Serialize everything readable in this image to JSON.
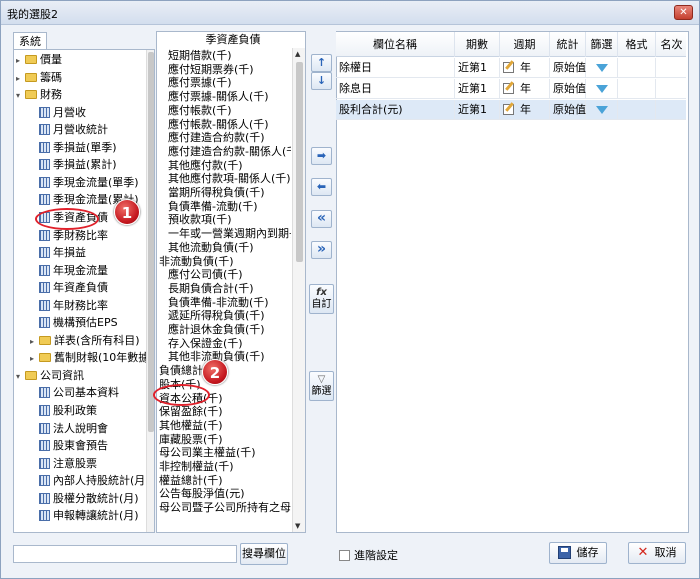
{
  "window": {
    "title": "我的選股2",
    "close_glyph": "✕"
  },
  "left_tab": {
    "label": "系統"
  },
  "tree": [
    {
      "indent": 0,
      "toggle": "▸",
      "icon": "folder",
      "label": "價量"
    },
    {
      "indent": 0,
      "toggle": "▸",
      "icon": "folder",
      "label": "籌碼"
    },
    {
      "indent": 0,
      "toggle": "▾",
      "icon": "folder",
      "label": "財務"
    },
    {
      "indent": 1,
      "toggle": "",
      "icon": "table",
      "label": "月營收"
    },
    {
      "indent": 1,
      "toggle": "",
      "icon": "table",
      "label": "月營收統計"
    },
    {
      "indent": 1,
      "toggle": "",
      "icon": "table",
      "label": "季損益(單季)"
    },
    {
      "indent": 1,
      "toggle": "",
      "icon": "table",
      "label": "季損益(累計)"
    },
    {
      "indent": 1,
      "toggle": "",
      "icon": "table",
      "label": "季現金流量(單季)"
    },
    {
      "indent": 1,
      "toggle": "",
      "icon": "table",
      "label": "季現金流量(累計)"
    },
    {
      "indent": 1,
      "toggle": "",
      "icon": "table",
      "label": "季資產負債"
    },
    {
      "indent": 1,
      "toggle": "",
      "icon": "table",
      "label": "季財務比率"
    },
    {
      "indent": 1,
      "toggle": "",
      "icon": "table",
      "label": "年損益"
    },
    {
      "indent": 1,
      "toggle": "",
      "icon": "table",
      "label": "年現金流量"
    },
    {
      "indent": 1,
      "toggle": "",
      "icon": "table",
      "label": "年資產負債"
    },
    {
      "indent": 1,
      "toggle": "",
      "icon": "table",
      "label": "年財務比率"
    },
    {
      "indent": 1,
      "toggle": "",
      "icon": "table",
      "label": "機構預估EPS"
    },
    {
      "indent": 1,
      "toggle": "▸",
      "icon": "folder",
      "label": "詳表(含所有科目)"
    },
    {
      "indent": 1,
      "toggle": "▸",
      "icon": "folder",
      "label": "舊制財報(10年數據)"
    },
    {
      "indent": 0,
      "toggle": "▾",
      "icon": "folder",
      "label": "公司資訊"
    },
    {
      "indent": 1,
      "toggle": "",
      "icon": "table",
      "label": "公司基本資料"
    },
    {
      "indent": 1,
      "toggle": "",
      "icon": "table",
      "label": "股利政策"
    },
    {
      "indent": 1,
      "toggle": "",
      "icon": "table",
      "label": "法人說明會"
    },
    {
      "indent": 1,
      "toggle": "",
      "icon": "table",
      "label": "股東會預告"
    },
    {
      "indent": 1,
      "toggle": "",
      "icon": "table",
      "label": "注意股票"
    },
    {
      "indent": 1,
      "toggle": "",
      "icon": "table",
      "label": "內部人持股統計(月)"
    },
    {
      "indent": 1,
      "toggle": "",
      "icon": "table",
      "label": "股權分散統計(月)"
    },
    {
      "indent": 1,
      "toggle": "",
      "icon": "table",
      "label": "申報轉讓統計(月)"
    }
  ],
  "middle": {
    "header": "季資產負債",
    "items": [
      {
        "indent": 1,
        "label": "短期借款(千)"
      },
      {
        "indent": 1,
        "label": "應付短期票券(千)"
      },
      {
        "indent": 1,
        "label": "應付票據(千)"
      },
      {
        "indent": 1,
        "label": "應付票據-關係人(千)"
      },
      {
        "indent": 1,
        "label": "應付帳款(千)"
      },
      {
        "indent": 1,
        "label": "應付帳款-關係人(千)"
      },
      {
        "indent": 1,
        "label": "應付建造合約款(千)"
      },
      {
        "indent": 1,
        "label": "應付建造合約款-關係人(千)"
      },
      {
        "indent": 1,
        "label": "其他應付款(千)"
      },
      {
        "indent": 1,
        "label": "其他應付款項-關係人(千)"
      },
      {
        "indent": 1,
        "label": "當期所得稅負債(千)"
      },
      {
        "indent": 1,
        "label": "負債準備-流動(千)"
      },
      {
        "indent": 1,
        "label": "預收款項(千)"
      },
      {
        "indent": 1,
        "label": "一年或一營業週期內到期長期"
      },
      {
        "indent": 1,
        "label": "其他流動負債(千)"
      },
      {
        "indent": 0,
        "label": "非流動負債(千)"
      },
      {
        "indent": 1,
        "label": "應付公司債(千)"
      },
      {
        "indent": 1,
        "label": "長期負債合計(千)"
      },
      {
        "indent": 1,
        "label": "負債準備-非流動(千)"
      },
      {
        "indent": 1,
        "label": "遞延所得稅負債(千)"
      },
      {
        "indent": 1,
        "label": "應計退休金負債(千)"
      },
      {
        "indent": 1,
        "label": "存入保證金(千)"
      },
      {
        "indent": 1,
        "label": "其他非流動負債(千)"
      },
      {
        "indent": 0,
        "label": "負債總計(千)"
      },
      {
        "indent": 0,
        "label": "股本(千)"
      },
      {
        "indent": 0,
        "label": "資本公積(千)"
      },
      {
        "indent": 0,
        "label": "保留盈餘(千)"
      },
      {
        "indent": 0,
        "label": "其他權益(千)"
      },
      {
        "indent": 0,
        "label": "庫藏股票(千)"
      },
      {
        "indent": 0,
        "label": "母公司業主權益(千)"
      },
      {
        "indent": 0,
        "label": "非控制權益(千)"
      },
      {
        "indent": 0,
        "label": "權益總計(千)"
      },
      {
        "indent": 0,
        "label": "公告每股淨值(元)"
      },
      {
        "indent": 0,
        "label": "母公司暨子公司所持有之母公司"
      }
    ]
  },
  "buttons": {
    "move_up": "↑",
    "move_down": "↓",
    "add_one": "➡",
    "remove_one": "⬅",
    "remove_all": "«",
    "add_all": "»",
    "custom_icon": "fx",
    "custom": "自訂",
    "filter_icon": "▽",
    "filter": "篩選"
  },
  "grid": {
    "columns": [
      "欄位名稱",
      "期數",
      "週期",
      "統計",
      "篩選",
      "格式",
      "名次"
    ],
    "rows": [
      {
        "name": "除權日",
        "period": "近第1",
        "cycle": "年",
        "stat": "原始值"
      },
      {
        "name": "除息日",
        "period": "近第1",
        "cycle": "年",
        "stat": "原始值"
      },
      {
        "name": "股利合計(元)",
        "period": "近第1",
        "cycle": "年",
        "stat": "原始值"
      }
    ]
  },
  "footer": {
    "search_value": "",
    "search_button": "搜尋欄位",
    "advanced": "進階設定",
    "save": "儲存",
    "cancel": "取消"
  },
  "annotations": {
    "badge1": "1",
    "badge2": "2"
  },
  "colors": {
    "highlight": "#e0212b",
    "selected_row": "#dde9f7"
  }
}
